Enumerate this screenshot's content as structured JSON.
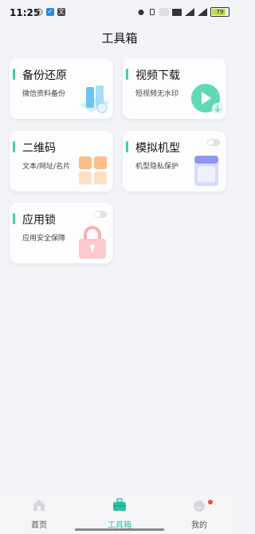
{
  "status_bar": {
    "time": "11:25",
    "battery": "79"
  },
  "page_title": "工具箱",
  "tools": [
    {
      "title": "备份还原",
      "subtitle": "微信资料备份"
    },
    {
      "title": "视频下载",
      "subtitle": "短视频无水印"
    },
    {
      "title": "二维码",
      "subtitle": "文本/网址/名片"
    },
    {
      "title": "模拟机型",
      "subtitle": "机型隐私保护",
      "toggle_on": false
    },
    {
      "title": "应用锁",
      "subtitle": "应用安全保障",
      "toggle_on": false
    }
  ],
  "nav": [
    {
      "label": "首页",
      "active": false
    },
    {
      "label": "工具箱",
      "active": true
    },
    {
      "label": "我的",
      "active": false,
      "badge": true
    }
  ],
  "colors": {
    "accent": "#3fcfb0",
    "nav_active": "#27c4a6",
    "nav_inactive": "#555555",
    "badge": "#f0503a"
  }
}
